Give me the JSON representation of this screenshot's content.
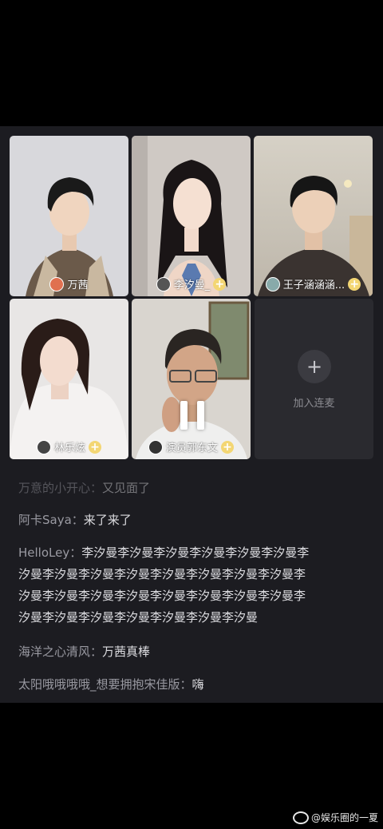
{
  "tiles": [
    {
      "name": "万茜",
      "has_plus": false
    },
    {
      "name": "李汐曼_",
      "has_plus": true
    },
    {
      "name": "王子涵涵涵...",
      "has_plus": true
    },
    {
      "name": "林乐炫",
      "has_plus": true
    },
    {
      "name": "演员郭东文",
      "has_plus": true
    }
  ],
  "empty_slot": {
    "label": "加入连麦",
    "icon": "plus-icon"
  },
  "player": {
    "state": "paused",
    "icon": "pause-icon"
  },
  "chat": [
    {
      "user": "万意的小开心：",
      "text": "又见面了"
    },
    {
      "user": "阿卡Saya：",
      "text": "来了来了"
    },
    {
      "user": "HelloLey：",
      "text": "李汐曼李汐曼李汐曼李汐曼李汐曼李汐曼李汐曼李汐曼李汐曼李汐曼李汐曼李汐曼李汐曼李汐曼李汐曼李汐曼李汐曼李汐曼李汐曼李汐曼李汐曼李汐曼李汐曼李汐曼李汐曼李汐曼李汐曼李汐曼李汐曼"
    },
    {
      "user": "海洋之心清风：",
      "text": "万茜真棒"
    },
    {
      "user": "太阳哦哦哦哦_想要拥抱宋佳版：",
      "text": "嗨"
    }
  ],
  "watermark": {
    "text": "@娱乐圈的一夏",
    "icon": "weibo-icon"
  }
}
